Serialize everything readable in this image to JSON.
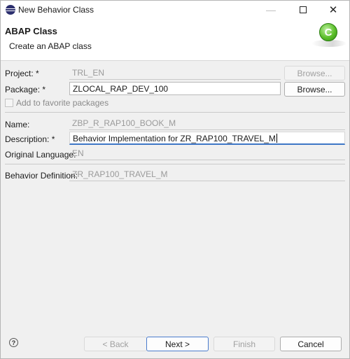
{
  "window": {
    "title": "New Behavior Class",
    "icon": "eclipse-icon"
  },
  "header": {
    "title": "ABAP Class",
    "description": "Create an ABAP class",
    "badge_letter": "C"
  },
  "form": {
    "project": {
      "label": "Project: *",
      "value": "TRL_EN",
      "browse_label": "Browse..."
    },
    "package": {
      "label": "Package: *",
      "value": "ZLOCAL_RAP_DEV_100",
      "browse_label": "Browse..."
    },
    "favorites": {
      "label": "Add to favorite packages",
      "checked": false
    },
    "name": {
      "label": "Name:",
      "value": "ZBP_R_RAP100_BOOK_M"
    },
    "description": {
      "label": "Description: *",
      "value": "Behavior Implementation for ZR_RAP100_TRAVEL_M"
    },
    "original_language": {
      "label": "Original Language:",
      "value": "EN"
    },
    "behavior_definition": {
      "label": "Behavior Definition:",
      "value": "ZR_RAP100_TRAVEL_M"
    }
  },
  "footer": {
    "help_icon": "help-icon",
    "back_label": "< Back",
    "next_label": "Next >",
    "finish_label": "Finish",
    "cancel_label": "Cancel"
  },
  "colors": {
    "focus_accent": "#3d76c6",
    "badge_green": "#5cbf2a",
    "app_icon": "#2c2f6e"
  }
}
